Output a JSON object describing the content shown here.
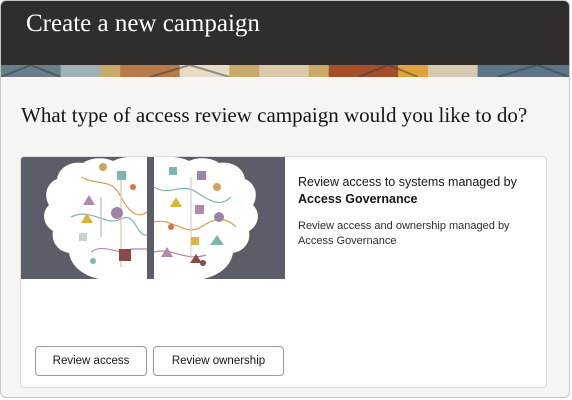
{
  "header": {
    "title": "Create a new campaign"
  },
  "question": "What type of access review campaign would you like to do?",
  "card": {
    "heading_prefix": "Review access to systems managed by ",
    "heading_bold": "Access Governance",
    "description": "Review access and ownership managed by Access Governance",
    "buttons": {
      "review_access": "Review access",
      "review_ownership": "Review ownership"
    }
  },
  "colors": {
    "header_bg": "#312d2a",
    "art_bg": "#5b5e68",
    "art_brain": "#ffffff"
  }
}
